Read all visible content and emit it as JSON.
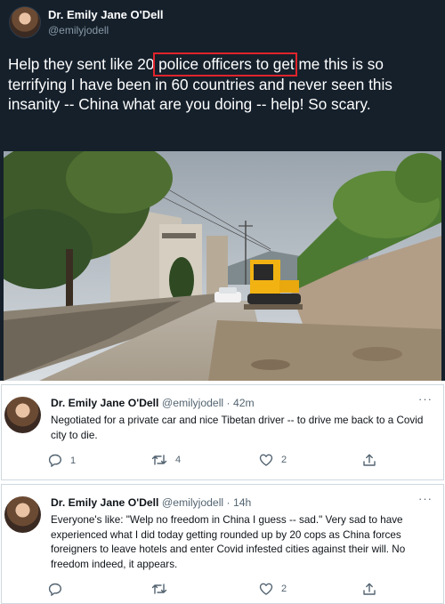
{
  "main_tweet": {
    "author_name": "Dr. Emily Jane O'Dell",
    "handle": "@emilyjodell",
    "text_before": "Help they sent like ",
    "text_highlight": "20 police officers",
    "text_after": " to get me this is so terrifying I have been in 60 countries and never seen this insanity -- China what are you doing -- help! So scary.",
    "highlight_color": "#e0242c",
    "background": "#15202b"
  },
  "replies": [
    {
      "author_name": "Dr. Emily Jane O'Dell",
      "handle": "@emilyjodell",
      "separator": "·",
      "time": "42m",
      "text": "Negotiated for a private car and nice Tibetan driver -- to drive me back to a Covid city to die.",
      "reply_count": "1",
      "retweet_count": "4",
      "like_count": "2"
    },
    {
      "author_name": "Dr. Emily Jane O'Dell",
      "handle": "@emilyjodell",
      "separator": "·",
      "time": "14h",
      "text": "Everyone's like: \"Welp no freedom in China I guess -- sad.\" Very sad to have experienced what I did today getting rounded up by 20 cops as China forces foreigners to leave hotels and enter Covid infested cities against their will. No freedom indeed, it appears.",
      "reply_count": "",
      "retweet_count": "",
      "like_count": "2"
    }
  ],
  "icons": {
    "more": "more-icon",
    "reply": "reply-icon",
    "retweet": "retweet-icon",
    "like": "like-icon",
    "share": "share-icon"
  },
  "more_label": "···"
}
